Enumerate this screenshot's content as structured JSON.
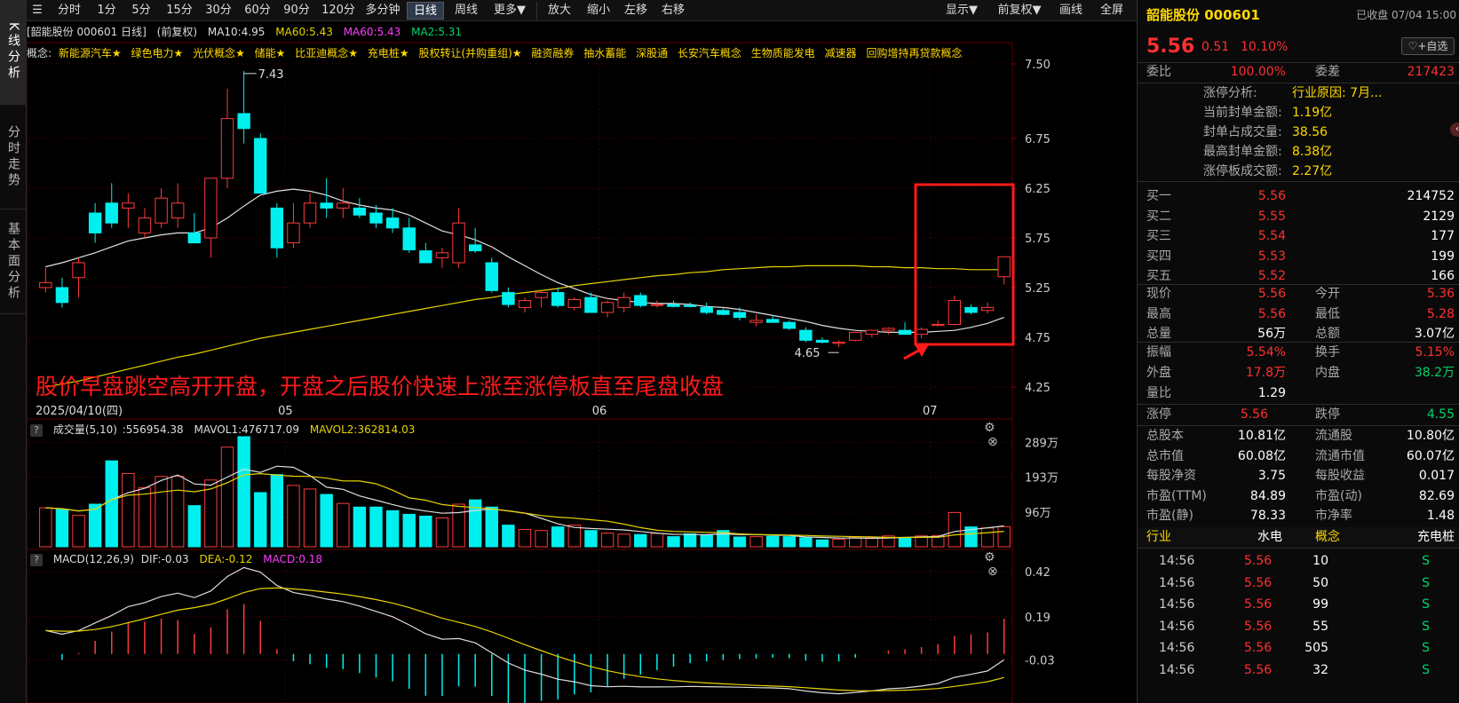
{
  "left_nav": [
    "K线分析",
    "分时走势",
    "基本面分析"
  ],
  "toolbar": {
    "periods": [
      "分时",
      "1分",
      "5分",
      "15分",
      "30分",
      "60分",
      "90分",
      "120分",
      "多分钟",
      "日线",
      "周线",
      "更多▼"
    ],
    "active": "日线",
    "actions": [
      "放大",
      "缩小",
      "左移",
      "右移"
    ],
    "right": [
      "显示▼",
      "前复权▼",
      "画线",
      "全屏"
    ]
  },
  "price_panel": {
    "info": {
      "title": "[韶能股份 000601 日线]",
      "adj": "(前复权)",
      "ma10": "MA10:4.95",
      "ma60a": "MA60:5.43",
      "ma60b": "MA60:5.43",
      "ma2": "MA2:5.31"
    },
    "concept_prefix": "概念:",
    "concepts": [
      "新能源汽车★",
      "绿色电力★",
      "光伏概念★",
      "储能★",
      "比亚迪概念★",
      "充电桩★",
      "股权转让(并购重组)★",
      "融资融券",
      "抽水蓄能",
      "深股通",
      "长安汽车概念",
      "生物质能发电",
      "减速器",
      "回购增持再贷款概念"
    ],
    "high_label": "7.43",
    "low_label": "4.65",
    "annotation": "股价早盘跳空高开开盘，开盘之后股价快速上涨至涨停板直至尾盘收盘",
    "date_labels": [
      "2025/04/10(四)",
      "05",
      "06",
      "07"
    ],
    "y_ticks": [
      "7.50",
      "6.75",
      "6.25",
      "5.75",
      "5.25",
      "4.75",
      "4.25"
    ]
  },
  "volume_panel": {
    "info": {
      "name": "成交量(5,10)",
      "vol": ":556954.38",
      "mavol1": "MAVOL1:476717.09",
      "mavol2": "MAVOL2:362814.03"
    },
    "y_ticks": [
      "289万",
      "193万",
      "96万"
    ]
  },
  "macd_panel": {
    "info": {
      "name": "MACD(12,26,9)",
      "dif": "DIF:-0.03",
      "dea": "DEA:-0.12",
      "macd": "MACD:0.18"
    },
    "y_ticks": [
      "0.42",
      "0.19",
      "-0.03"
    ]
  },
  "chart_data": [
    {
      "type": "candlestick",
      "title": "韶能股份 000601 日线",
      "x_labels": [
        "2025/04/10(四)",
        "05",
        "06",
        "07"
      ],
      "ylim": [
        4.25,
        7.5
      ],
      "candles": [
        {
          "o": 5.25,
          "h": 5.45,
          "l": 5.2,
          "c": 5.3
        },
        {
          "o": 5.25,
          "h": 5.35,
          "l": 5.05,
          "c": 5.1
        },
        {
          "o": 5.35,
          "h": 5.55,
          "l": 5.15,
          "c": 5.5
        },
        {
          "o": 6.0,
          "h": 6.1,
          "l": 5.7,
          "c": 5.8
        },
        {
          "o": 6.1,
          "h": 6.3,
          "l": 5.85,
          "c": 5.9
        },
        {
          "o": 6.05,
          "h": 6.2,
          "l": 5.85,
          "c": 6.1
        },
        {
          "o": 5.8,
          "h": 6.05,
          "l": 5.75,
          "c": 5.95
        },
        {
          "o": 5.9,
          "h": 6.25,
          "l": 5.85,
          "c": 6.15
        },
        {
          "o": 5.95,
          "h": 6.3,
          "l": 5.85,
          "c": 6.1
        },
        {
          "o": 5.8,
          "h": 6.0,
          "l": 5.7,
          "c": 5.7
        },
        {
          "o": 5.75,
          "h": 6.35,
          "l": 5.55,
          "c": 6.35
        },
        {
          "o": 6.35,
          "h": 7.25,
          "l": 6.25,
          "c": 6.95
        },
        {
          "o": 7.0,
          "h": 7.43,
          "l": 6.7,
          "c": 6.85
        },
        {
          "o": 6.75,
          "h": 6.8,
          "l": 6.2,
          "c": 6.2
        },
        {
          "o": 6.05,
          "h": 6.1,
          "l": 5.55,
          "c": 5.65
        },
        {
          "o": 5.7,
          "h": 6.1,
          "l": 5.65,
          "c": 5.9
        },
        {
          "o": 5.9,
          "h": 6.2,
          "l": 5.85,
          "c": 6.1
        },
        {
          "o": 6.1,
          "h": 6.35,
          "l": 5.95,
          "c": 6.05
        },
        {
          "o": 6.05,
          "h": 6.25,
          "l": 5.95,
          "c": 6.1
        },
        {
          "o": 6.05,
          "h": 6.15,
          "l": 5.95,
          "c": 5.98
        },
        {
          "o": 6.0,
          "h": 6.08,
          "l": 5.85,
          "c": 5.9
        },
        {
          "o": 5.95,
          "h": 6.05,
          "l": 5.8,
          "c": 5.85
        },
        {
          "o": 5.85,
          "h": 5.95,
          "l": 5.6,
          "c": 5.63
        },
        {
          "o": 5.62,
          "h": 5.7,
          "l": 5.5,
          "c": 5.5
        },
        {
          "o": 5.55,
          "h": 5.65,
          "l": 5.45,
          "c": 5.6
        },
        {
          "o": 5.5,
          "h": 6.05,
          "l": 5.45,
          "c": 5.9
        },
        {
          "o": 5.68,
          "h": 5.85,
          "l": 5.6,
          "c": 5.62
        },
        {
          "o": 5.5,
          "h": 5.55,
          "l": 5.2,
          "c": 5.22
        },
        {
          "o": 5.2,
          "h": 5.25,
          "l": 5.05,
          "c": 5.08
        },
        {
          "o": 5.05,
          "h": 5.15,
          "l": 5.0,
          "c": 5.12
        },
        {
          "o": 5.15,
          "h": 5.22,
          "l": 5.05,
          "c": 5.2
        },
        {
          "o": 5.2,
          "h": 5.25,
          "l": 5.05,
          "c": 5.07
        },
        {
          "o": 5.05,
          "h": 5.15,
          "l": 5.02,
          "c": 5.13
        },
        {
          "o": 5.15,
          "h": 5.2,
          "l": 5.05,
          "c": 5.0
        },
        {
          "o": 5.0,
          "h": 5.12,
          "l": 4.95,
          "c": 5.1
        },
        {
          "o": 5.05,
          "h": 5.2,
          "l": 5.0,
          "c": 5.15
        },
        {
          "o": 5.17,
          "h": 5.2,
          "l": 5.05,
          "c": 5.07
        },
        {
          "o": 5.08,
          "h": 5.12,
          "l": 5.05,
          "c": 5.08
        },
        {
          "o": 5.08,
          "h": 5.12,
          "l": 5.05,
          "c": 5.06
        },
        {
          "o": 5.07,
          "h": 5.1,
          "l": 5.05,
          "c": 5.06
        },
        {
          "o": 5.05,
          "h": 5.1,
          "l": 4.98,
          "c": 5.0
        },
        {
          "o": 5.02,
          "h": 5.05,
          "l": 4.97,
          "c": 4.98
        },
        {
          "o": 5.0,
          "h": 5.05,
          "l": 4.92,
          "c": 4.95
        },
        {
          "o": 4.9,
          "h": 4.98,
          "l": 4.86,
          "c": 4.92
        },
        {
          "o": 4.93,
          "h": 4.97,
          "l": 4.9,
          "c": 4.9
        },
        {
          "o": 4.9,
          "h": 4.92,
          "l": 4.82,
          "c": 4.84
        },
        {
          "o": 4.82,
          "h": 4.85,
          "l": 4.7,
          "c": 4.72
        },
        {
          "o": 4.72,
          "h": 4.75,
          "l": 4.69,
          "c": 4.7
        },
        {
          "o": 4.7,
          "h": 4.72,
          "l": 4.65,
          "c": 4.7
        },
        {
          "o": 4.72,
          "h": 4.8,
          "l": 4.71,
          "c": 4.8
        },
        {
          "o": 4.78,
          "h": 4.82,
          "l": 4.75,
          "c": 4.82
        },
        {
          "o": 4.82,
          "h": 4.85,
          "l": 4.78,
          "c": 4.84
        },
        {
          "o": 4.82,
          "h": 4.9,
          "l": 4.78,
          "c": 4.78
        },
        {
          "o": 4.78,
          "h": 4.85,
          "l": 4.74,
          "c": 4.83
        },
        {
          "o": 4.88,
          "h": 4.92,
          "l": 4.86,
          "c": 4.88
        },
        {
          "o": 4.88,
          "h": 5.17,
          "l": 4.87,
          "c": 5.12
        },
        {
          "o": 5.05,
          "h": 5.08,
          "l": 4.98,
          "c": 5.0
        },
        {
          "o": 5.02,
          "h": 5.1,
          "l": 4.99,
          "c": 5.05
        },
        {
          "o": 5.36,
          "h": 5.56,
          "l": 5.28,
          "c": 5.56
        }
      ],
      "ma10": [
        5.46,
        5.5,
        5.55,
        5.6,
        5.66,
        5.72,
        5.75,
        5.78,
        5.8,
        5.8,
        5.85,
        5.95,
        6.07,
        6.18,
        6.22,
        6.24,
        6.22,
        6.18,
        6.12,
        6.08,
        6.05,
        6.03,
        5.98,
        5.9,
        5.82,
        5.78,
        5.73,
        5.66,
        5.56,
        5.47,
        5.38,
        5.3,
        5.24,
        5.18,
        5.14,
        5.12,
        5.1,
        5.09,
        5.09,
        5.08,
        5.06,
        5.05,
        5.03,
        5.0,
        4.97,
        4.94,
        4.91,
        4.87,
        4.84,
        4.82,
        4.81,
        4.8,
        4.8,
        4.8,
        4.81,
        4.82,
        4.85,
        4.89,
        4.95
      ],
      "ma60": [
        4.25,
        4.28,
        4.31,
        4.35,
        4.39,
        4.43,
        4.47,
        4.51,
        4.55,
        4.58,
        4.62,
        4.66,
        4.7,
        4.74,
        4.77,
        4.8,
        4.83,
        4.86,
        4.89,
        4.92,
        4.95,
        4.98,
        5.01,
        5.04,
        5.07,
        5.1,
        5.13,
        5.15,
        5.18,
        5.2,
        5.22,
        5.24,
        5.27,
        5.29,
        5.31,
        5.33,
        5.35,
        5.37,
        5.38,
        5.4,
        5.41,
        5.43,
        5.44,
        5.45,
        5.46,
        5.46,
        5.47,
        5.47,
        5.47,
        5.47,
        5.46,
        5.46,
        5.45,
        5.45,
        5.44,
        5.44,
        5.43,
        5.43,
        5.43
      ]
    },
    {
      "type": "bar",
      "title": "成交量(5,10)",
      "ylim": [
        0,
        3000000
      ],
      "values": [
        1080000,
        1030000,
        870000,
        1180000,
        2380000,
        2030000,
        1640000,
        1950000,
        1950000,
        1140000,
        1850000,
        2760000,
        3050000,
        1500000,
        2000000,
        1700000,
        1600000,
        1450000,
        1200000,
        1100000,
        1100000,
        1000000,
        900000,
        850000,
        800000,
        1180000,
        1300000,
        1100000,
        600000,
        480000,
        450000,
        550000,
        600000,
        450000,
        380000,
        350000,
        340000,
        370000,
        280000,
        360000,
        320000,
        450000,
        270000,
        280000,
        290000,
        280000,
        250000,
        190000,
        210000,
        270000,
        250000,
        300000,
        260000,
        300000,
        310000,
        950000,
        550000,
        520000,
        557000
      ]
    },
    {
      "type": "bar",
      "title": "MACD(12,26,9)",
      "ylim": [
        -0.25,
        0.42
      ],
      "dif": -0.03,
      "dea": -0.12,
      "macd": 0.18
    }
  ],
  "right_panel": {
    "stock_name": "韶能股份 000601",
    "status": "已收盘 07/04 15:00",
    "price": "5.56",
    "change": "0.51",
    "change_pct": "10.10%",
    "watch_btn": "+自选",
    "weibi_label": "委比",
    "weibi_value": "100.00%",
    "weicha_label": "委差",
    "weicha_value": "217423",
    "limit_analysis": [
      {
        "label": "涨停分析:",
        "value": "行业原因: 7月..."
      },
      {
        "label": "当前封单金额:",
        "value": "1.19亿"
      },
      {
        "label": "封单占成交量:",
        "value": "38.56"
      },
      {
        "label": "最高封单金额:",
        "value": "8.38亿"
      },
      {
        "label": "涨停板成交额:",
        "value": "2.27亿"
      }
    ],
    "bids": [
      {
        "label": "买一",
        "price": "5.56",
        "vol": "214752"
      },
      {
        "label": "买二",
        "price": "5.55",
        "vol": "2129"
      },
      {
        "label": "买三",
        "price": "5.54",
        "vol": "177"
      },
      {
        "label": "买四",
        "price": "5.53",
        "vol": "199"
      },
      {
        "label": "买五",
        "price": "5.52",
        "vol": "166"
      }
    ],
    "stats": [
      [
        "现价",
        "5.56",
        "今开",
        "5.36"
      ],
      [
        "最高",
        "5.56",
        "最低",
        "5.28"
      ],
      [
        "总量",
        "56万",
        "总额",
        "3.07亿"
      ]
    ],
    "stats2": [
      [
        "振幅",
        "5.54%",
        "换手",
        "5.15%"
      ],
      [
        "外盘",
        "17.8万",
        "内盘",
        "38.2万"
      ],
      [
        "量比",
        "1.29",
        "",
        ""
      ]
    ],
    "limits": [
      "涨停",
      "5.56",
      "跌停",
      "4.55"
    ],
    "fundamentals": [
      [
        "总股本",
        "10.81亿",
        "流通股",
        "10.80亿"
      ],
      [
        "总市值",
        "60.08亿",
        "流通市值",
        "60.07亿"
      ],
      [
        "每股净资",
        "3.75",
        "每股收益",
        "0.017"
      ],
      [
        "市盈(TTM)",
        "84.89",
        "市盈(动)",
        "82.69"
      ],
      [
        "市盈(静)",
        "78.33",
        "市净率",
        "1.48"
      ]
    ],
    "industry": [
      "行业",
      "水电",
      "概念",
      "充电桩"
    ],
    "ticks": [
      {
        "time": "14:56",
        "price": "5.56",
        "vol": "10",
        "dir": "S"
      },
      {
        "time": "14:56",
        "price": "5.56",
        "vol": "50",
        "dir": "S"
      },
      {
        "time": "14:56",
        "price": "5.56",
        "vol": "99",
        "dir": "S"
      },
      {
        "time": "14:56",
        "price": "5.56",
        "vol": "55",
        "dir": "S"
      },
      {
        "time": "14:56",
        "price": "5.56",
        "vol": "505",
        "dir": "S"
      },
      {
        "time": "14:56",
        "price": "5.56",
        "vol": "32",
        "dir": "S"
      }
    ]
  },
  "colors": {
    "up": "#ff3b3b",
    "down": "#00f0f0",
    "ma10": "#e0e0e0",
    "ma60": "#e6d400",
    "highlight_box": "#ff1a1a",
    "annotation": "#ff1a1a"
  }
}
